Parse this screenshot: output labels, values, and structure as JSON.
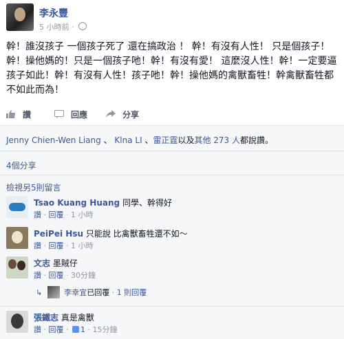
{
  "post": {
    "author": "李永豐",
    "time": "5 小時前",
    "text": "幹！誰沒孩子 一個孩子死了 還在搞政治 ！ 幹！有沒有人性！ 只是個孩子！幹！操他媽的！只是一個孩子吔！幹！有沒有愛！ 這麼沒人性！幹！一定要逼孩子如此！幹！有沒有人性！孩子吔！幹！操他媽的禽獸畜牲！幹禽獸畜牲都不如此而為！"
  },
  "actions": {
    "like": "讚",
    "comment": "回應",
    "share": "分享"
  },
  "likes": {
    "name1": "Jenny Chien-Wen Liang",
    "sep1": " 、 ",
    "name2": "Klna LI",
    "sep2": " 、",
    "name3": "雷正霆",
    "mid": "以及",
    "others": "其他 273 人",
    "end": "都說讚。"
  },
  "shares": "4個分享",
  "more_comments": "檢視另5則留言",
  "comments": [
    {
      "name": "Tsao Kuang Huang",
      "text": "同學、幹得好",
      "like": "讚",
      "reply": "回覆",
      "time": "1 小時"
    },
    {
      "name": "PeiPei Hsu",
      "text": "只能說 比禽獸畜牲還不如～",
      "like": "讚",
      "reply": "回覆",
      "time": "1 小時"
    },
    {
      "name": "文志",
      "text": "墨賊仔",
      "like": "讚",
      "reply": "回覆",
      "time": "30分鐘"
    },
    {
      "name": "張鐵志",
      "text": "真是禽獸",
      "like": "讚",
      "reply": "回覆",
      "likes": "1",
      "time": "15分鐘"
    }
  ],
  "reply": {
    "name": "李幸宜",
    "action": "已回覆",
    "count": "1 則回覆"
  },
  "sep": " · "
}
